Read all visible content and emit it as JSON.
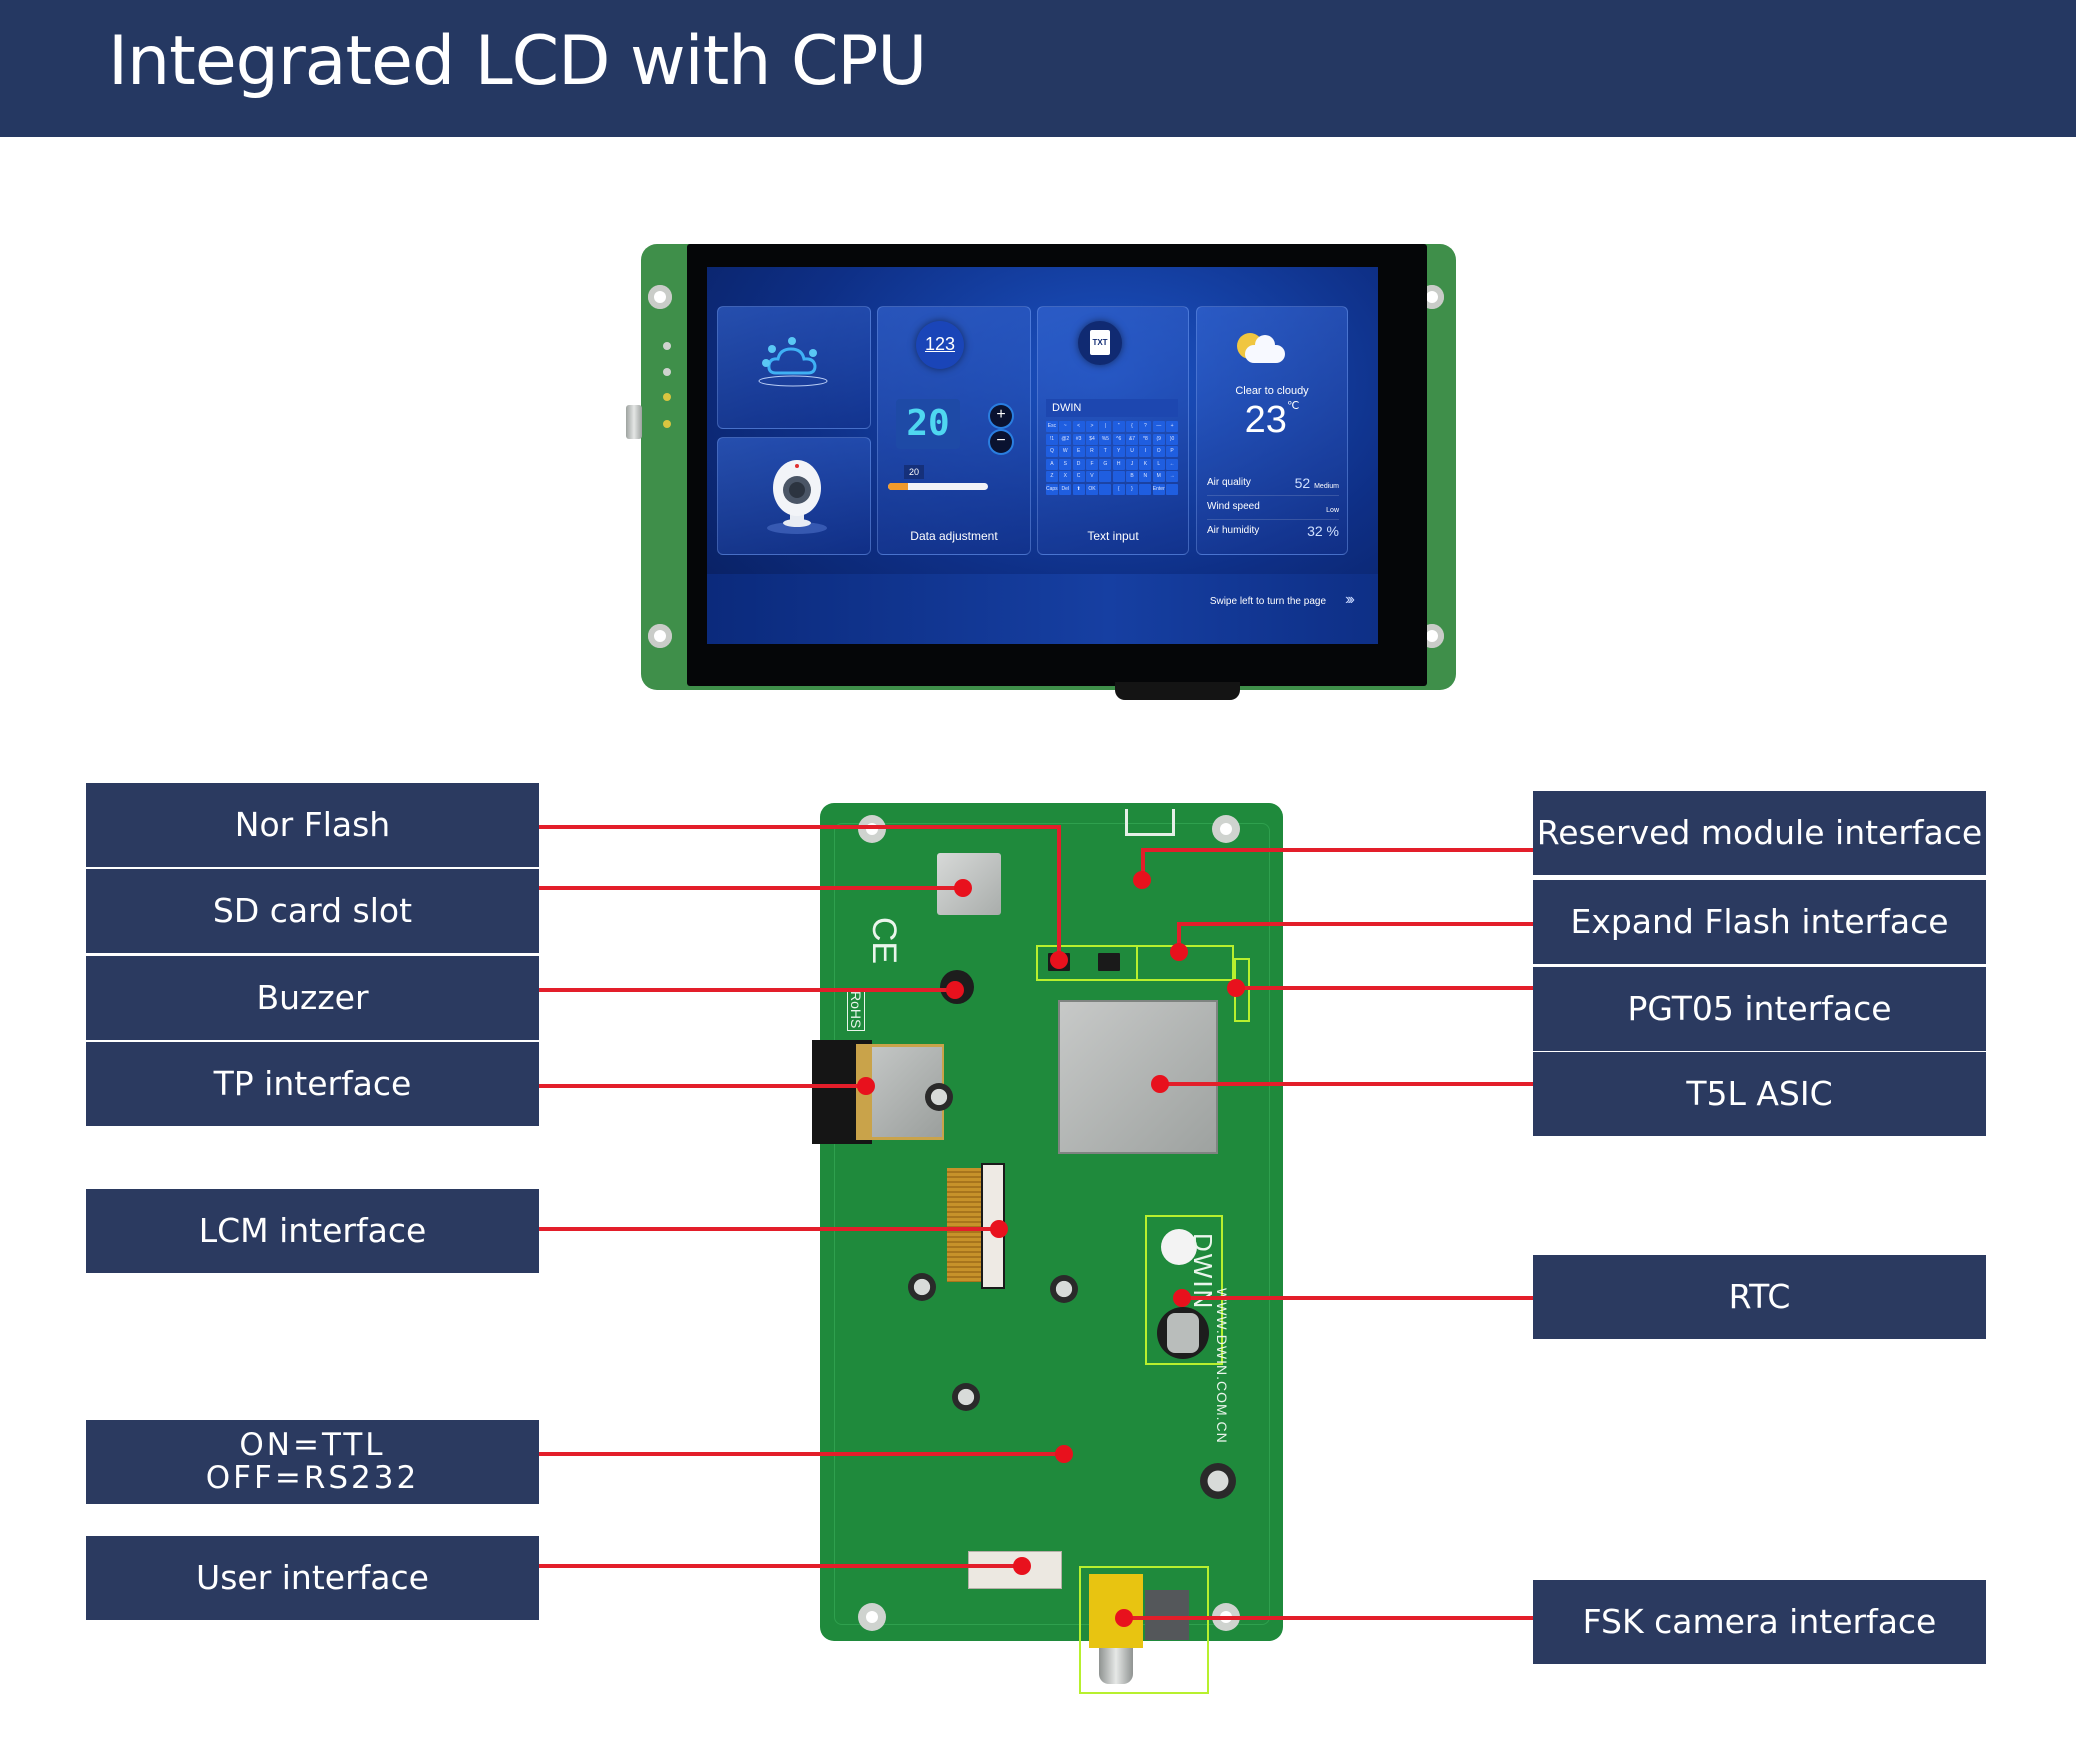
{
  "header": {
    "title": "Integrated LCD with CPU"
  },
  "colors": {
    "header_bg": "#253862",
    "label_bg": "#2b3a60",
    "leader_line": "#e31e2a",
    "highlight_box": "#b7f02e",
    "pcb_green": "#1f8a3c"
  },
  "lcd_screen": {
    "cards": {
      "iot": {
        "icon": "cloud-iot-icon"
      },
      "camera": {
        "icon": "webcam-icon"
      },
      "data_adjustment": {
        "badge": "123",
        "value": "20",
        "plus": "+",
        "minus": "−",
        "slider_tip": "20",
        "slider_fraction": 0.2,
        "label": "Data adjustment"
      },
      "text_input": {
        "badge": "TXT",
        "field_value": "DWIN",
        "keys": [
          "Esc",
          "~",
          "<",
          ">",
          "|",
          "\"",
          "{",
          "?",
          "—",
          "+",
          "!1",
          "@2",
          "#3",
          "$4",
          "%5",
          "^6",
          "&7",
          "*8",
          "(9",
          ")0",
          "Q",
          "W",
          "E",
          "R",
          "T",
          "Y",
          "U",
          "I",
          "O",
          "P",
          "A",
          "S",
          "D",
          "F",
          "G",
          "H",
          "J",
          "K",
          "L",
          "←",
          "Z",
          "X",
          "C",
          "V",
          "",
          "",
          "B",
          "N",
          "M",
          "→",
          "Caps Lock",
          "Del",
          "⬆",
          "OK",
          "",
          "{",
          "}",
          "",
          "Enter",
          ""
        ],
        "label": "Text input"
      },
      "weather": {
        "description": "Clear to cloudy",
        "temperature": "23",
        "unit": "℃",
        "rows": [
          {
            "key": "Air quality",
            "value": "52",
            "note": "Medium"
          },
          {
            "key": "Wind speed",
            "value": "",
            "note": "Low"
          },
          {
            "key": "Air humidity",
            "value": "32 %",
            "note": ""
          }
        ]
      }
    },
    "footer": {
      "swipe_text": "Swipe left to turn the page",
      "arrows": "›››"
    }
  },
  "board": {
    "silkscreen": {
      "brand": "DWIN",
      "url": "WWW.DWIN.COM.CN",
      "rohs": "RoHS",
      "ce": "CE"
    }
  },
  "callouts": {
    "left": [
      {
        "id": "nor-flash",
        "text": "Nor Flash"
      },
      {
        "id": "sd-card-slot",
        "text": "SD card slot"
      },
      {
        "id": "buzzer",
        "text": "Buzzer"
      },
      {
        "id": "tp-interface",
        "text": "TP interface"
      },
      {
        "id": "lcm-interface",
        "text": "LCM interface"
      },
      {
        "id": "ttl-rs232-switch",
        "line1": "ON=TTL",
        "line2": "OFF=RS232"
      },
      {
        "id": "user-interface",
        "text": "User interface"
      }
    ],
    "right": [
      {
        "id": "reserved-module-interface",
        "text": "Reserved module interface"
      },
      {
        "id": "expand-flash-interface",
        "text": "Expand Flash interface"
      },
      {
        "id": "pgt05-interface",
        "text": "PGT05 interface"
      },
      {
        "id": "t5l-asic",
        "text": "T5L ASIC"
      },
      {
        "id": "rtc",
        "text": "RTC"
      },
      {
        "id": "fsk-camera-interface",
        "text": "FSK camera interface"
      }
    ]
  }
}
